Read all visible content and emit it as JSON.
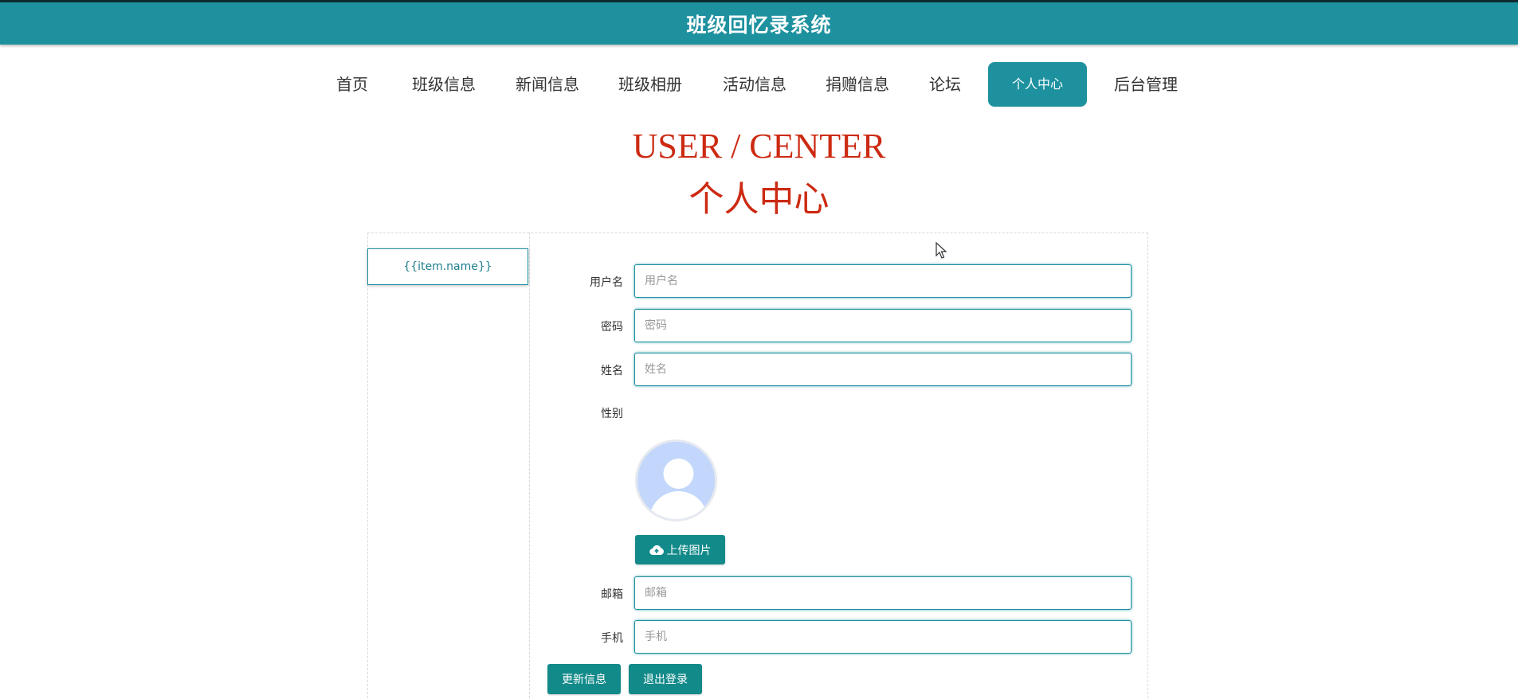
{
  "header": {
    "title": "班级回忆录系统"
  },
  "nav": {
    "items": [
      {
        "label": "首页"
      },
      {
        "label": "班级信息"
      },
      {
        "label": "新闻信息"
      },
      {
        "label": "班级相册"
      },
      {
        "label": "活动信息"
      },
      {
        "label": "捐赠信息"
      },
      {
        "label": "论坛"
      },
      {
        "label": "个人中心",
        "active": true
      },
      {
        "label": "后台管理"
      }
    ]
  },
  "page": {
    "title_en": "USER / CENTER",
    "title_cn": "个人中心"
  },
  "sidebar": {
    "items": [
      {
        "label": "{{item.name}}"
      }
    ]
  },
  "form": {
    "username": {
      "label": "用户名",
      "placeholder": "用户名",
      "value": ""
    },
    "password": {
      "label": "密码",
      "placeholder": "密码",
      "value": ""
    },
    "name": {
      "label": "姓名",
      "placeholder": "姓名",
      "value": ""
    },
    "gender": {
      "label": "性别"
    },
    "upload_button": "上传图片",
    "email": {
      "label": "邮箱",
      "placeholder": "邮箱",
      "value": ""
    },
    "phone": {
      "label": "手机",
      "placeholder": "手机",
      "value": ""
    }
  },
  "actions": {
    "update": "更新信息",
    "logout": "退出登录"
  },
  "colors": {
    "accent": "#1e919f",
    "button": "#138a8a",
    "heading": "#cc2a12"
  }
}
